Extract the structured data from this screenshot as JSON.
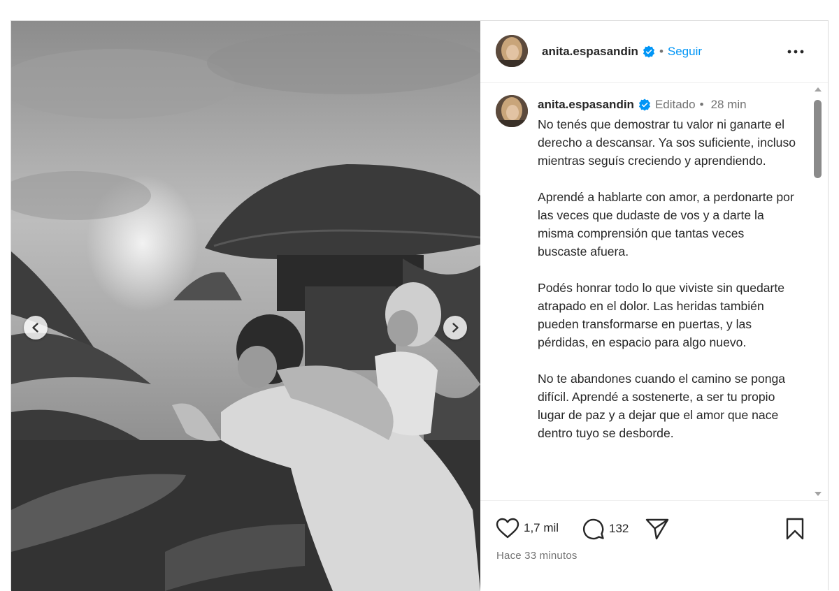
{
  "header": {
    "username": "anita.espasandin",
    "separator": "•",
    "follow_label": "Seguir"
  },
  "caption": {
    "username": "anita.espasandin",
    "edited_label": "Editado",
    "separator": "•",
    "time": "28 min",
    "paragraphs": [
      "No tenés que demostrar tu valor ni ganarte el derecho a descansar. Ya sos suficiente, incluso mientras seguís creciendo y aprendiendo.",
      "Aprendé a hablarte con amor, a perdonarte por las veces que dudaste de vos y a darte la misma comprensión que tantas veces buscaste afuera.",
      "Podés honrar todo lo que viviste sin quedarte atrapado en el dolor. Las heridas también pueden transformarse en puertas, y las pérdidas, en espacio para algo nuevo.",
      "No te abandones cuando el camino se ponga difícil. Aprendé a sostenerte, a ser tu propio lugar de paz y a dejar que el amor que nace dentro tuyo se desborde."
    ]
  },
  "actions": {
    "likes": "1,7 mil",
    "comments": "132",
    "posted": "Hace 33 minutos"
  },
  "icons": {
    "verified": "verified-badge-icon",
    "more": "more-options-icon",
    "like": "heart-icon",
    "comment": "comment-bubble-icon",
    "share": "send-icon",
    "save": "bookmark-icon",
    "prev": "chevron-left-icon",
    "next": "chevron-right-icon"
  },
  "colors": {
    "link": "#0095f6",
    "text": "#262626",
    "muted": "#737373",
    "verified": "#0095f6"
  }
}
